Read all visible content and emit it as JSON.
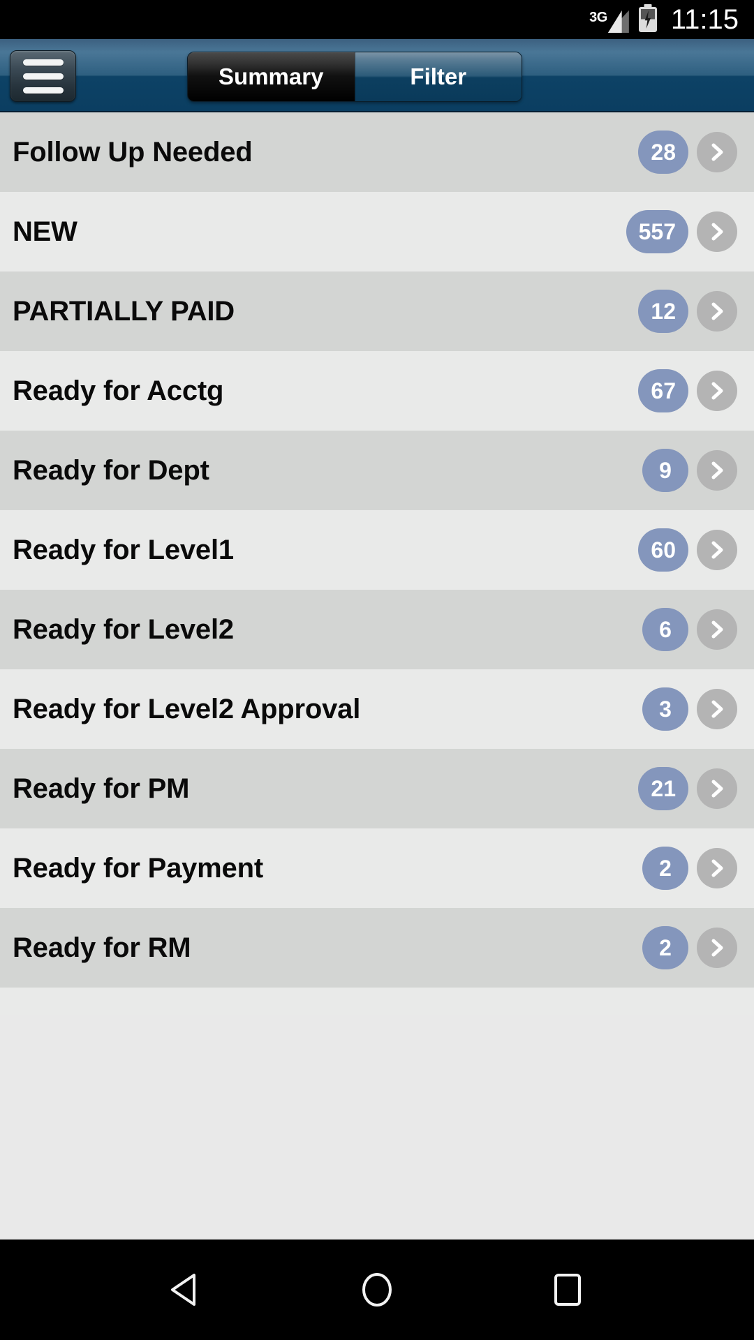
{
  "status_bar": {
    "network_label": "3G",
    "signal_icon": "signal-triangle-icon",
    "battery_icon": "battery-charging-icon",
    "time": "11:15"
  },
  "header": {
    "menu_icon": "hamburger-menu-icon",
    "segments": [
      {
        "label": "Summary",
        "active": true
      },
      {
        "label": "Filter",
        "active": false
      }
    ]
  },
  "list": {
    "rows": [
      {
        "title": "Follow Up Needed",
        "count": "28"
      },
      {
        "title": "NEW",
        "count": "557"
      },
      {
        "title": "PARTIALLY PAID",
        "count": "12"
      },
      {
        "title": "Ready for Acctg",
        "count": "67"
      },
      {
        "title": "Ready for Dept",
        "count": "9"
      },
      {
        "title": "Ready for Level1",
        "count": "60"
      },
      {
        "title": "Ready for Level2",
        "count": "6"
      },
      {
        "title": "Ready for Level2 Approval",
        "count": "3"
      },
      {
        "title": "Ready for PM",
        "count": "21"
      },
      {
        "title": "Ready for Payment",
        "count": "2"
      },
      {
        "title": "Ready for RM",
        "count": "2"
      }
    ],
    "chevron_icon": "chevron-right-icon"
  },
  "nav_bar": {
    "back_icon": "back-triangle-icon",
    "home_icon": "home-circle-icon",
    "recents_icon": "recents-square-icon"
  },
  "colors": {
    "badge": "#8496bc",
    "chevron_circle": "#b4b4b4",
    "row_odd": "#d3d5d3",
    "row_even": "#e9eae9",
    "header_blue": "#0b3e61"
  }
}
